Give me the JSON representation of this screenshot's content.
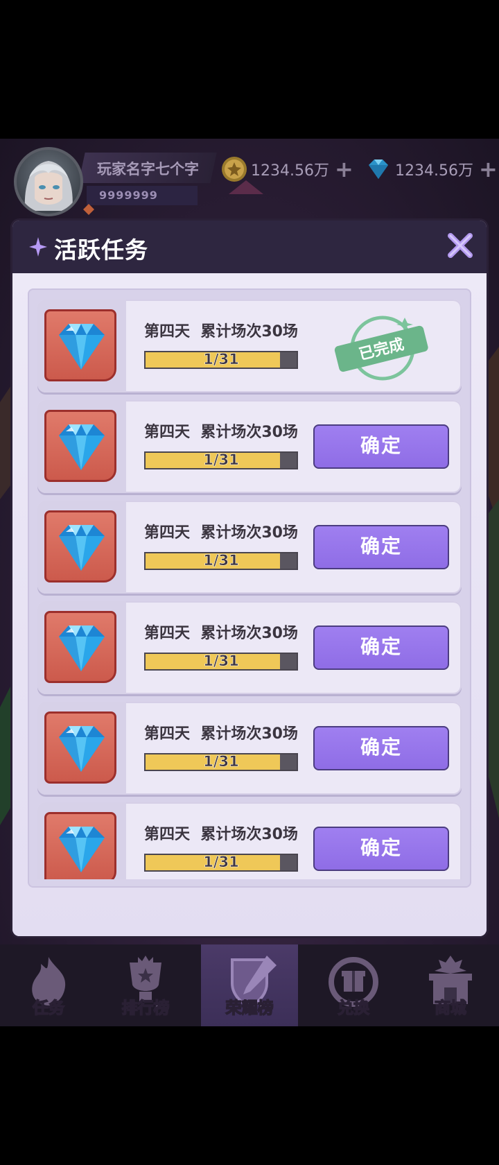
{
  "header": {
    "player_name": "玩家名字七个字",
    "player_id": "9999999",
    "gold_amount": "1234.56万",
    "gem_amount": "1234.56万"
  },
  "modal": {
    "title": "活跃任务",
    "close_icon": "close-x-icon"
  },
  "tasks": [
    {
      "title": "第四天  累计场次30场",
      "progress_text": "1/31",
      "progress": 0.89,
      "status": "completed",
      "stamp_label": "已完成"
    },
    {
      "title": "第四天  累计场次30场",
      "progress_text": "1/31",
      "progress": 0.89,
      "status": "claimable",
      "button_label": "确定"
    },
    {
      "title": "第四天  累计场次30场",
      "progress_text": "1/31",
      "progress": 0.89,
      "status": "claimable",
      "button_label": "确定"
    },
    {
      "title": "第四天  累计场次30场",
      "progress_text": "1/31",
      "progress": 0.89,
      "status": "claimable",
      "button_label": "确定"
    },
    {
      "title": "第四天  累计场次30场",
      "progress_text": "1/31",
      "progress": 0.89,
      "status": "claimable",
      "button_label": "确定"
    },
    {
      "title": "第四天  累计场次30场",
      "progress_text": "1/31",
      "progress": 0.89,
      "status": "claimable",
      "button_label": "确定"
    }
  ],
  "nav": [
    {
      "label": "任务",
      "icon": "flame-icon",
      "active": false
    },
    {
      "label": "排行榜",
      "icon": "trophy-icon",
      "active": false
    },
    {
      "label": "荣耀榜",
      "icon": "shield-sword-icon",
      "active": true
    },
    {
      "label": "兑换",
      "icon": "gift-exchange-icon",
      "active": false
    },
    {
      "label": "商城",
      "icon": "shop-icon",
      "active": false
    }
  ],
  "colors": {
    "accent_purple": "#9b7bee",
    "progress_yellow": "#efc858",
    "completed_green": "#6bb58a"
  }
}
